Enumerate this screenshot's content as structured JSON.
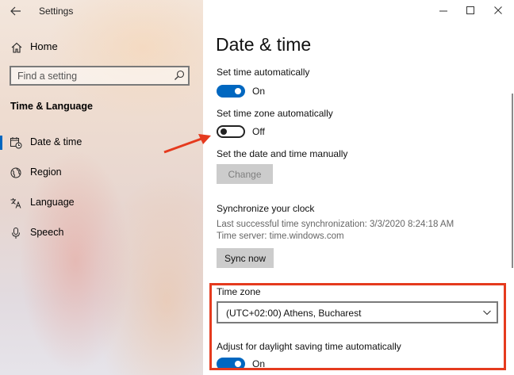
{
  "app": {
    "title": "Settings"
  },
  "sidebar": {
    "home_label": "Home",
    "search": {
      "placeholder": "Find a setting"
    },
    "section_title": "Time & Language",
    "items": [
      {
        "label": "Date & time",
        "icon": "calendar-clock-icon",
        "active": true
      },
      {
        "label": "Region",
        "icon": "globe-icon",
        "active": false
      },
      {
        "label": "Language",
        "icon": "language-icon",
        "active": false
      },
      {
        "label": "Speech",
        "icon": "microphone-icon",
        "active": false
      }
    ]
  },
  "main": {
    "title": "Date & time",
    "set_time_auto": {
      "label": "Set time automatically",
      "state": "On"
    },
    "set_zone_auto": {
      "label": "Set time zone automatically",
      "state": "Off"
    },
    "manual": {
      "label": "Set the date and time manually",
      "button": "Change"
    },
    "sync": {
      "heading": "Synchronize your clock",
      "last_sync": "Last successful time synchronization: 3/3/2020 8:24:18 AM",
      "server": "Time server: time.windows.com",
      "button": "Sync now"
    },
    "time_zone": {
      "label": "Time zone",
      "value": "(UTC+02:00) Athens, Bucharest"
    },
    "dst": {
      "label": "Adjust for daylight saving time automatically",
      "state": "On"
    }
  },
  "colors": {
    "accent": "#0067c0",
    "highlight": "#e53a1e"
  }
}
